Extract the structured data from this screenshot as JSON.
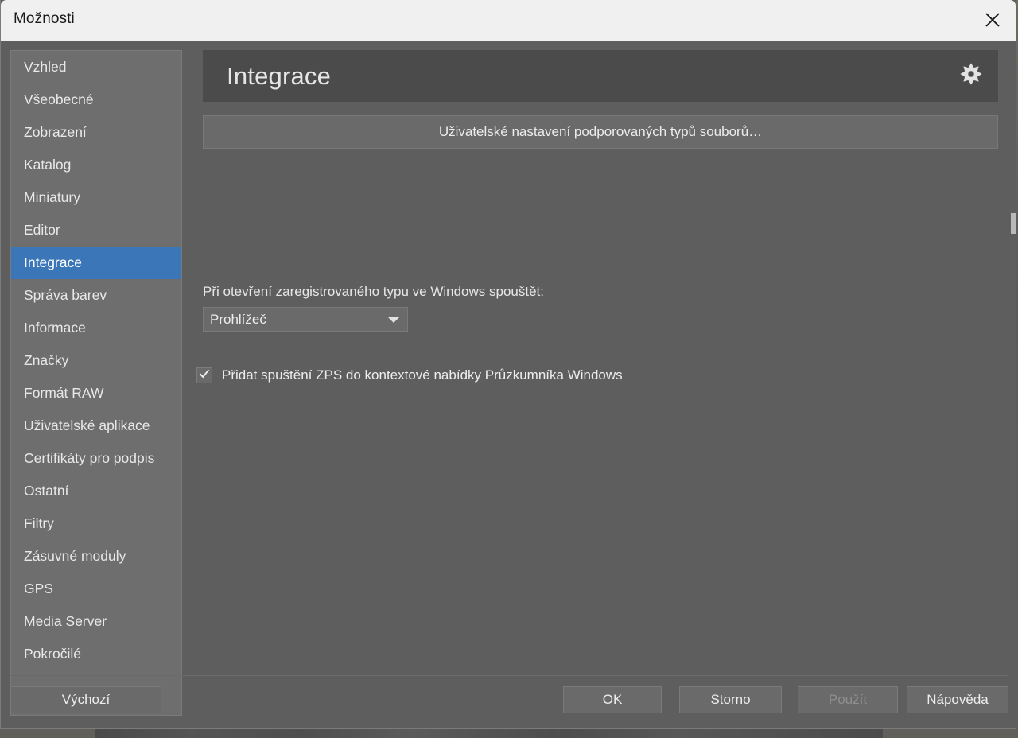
{
  "window": {
    "title": "Možnosti",
    "close_icon": "close-icon"
  },
  "sidebar": {
    "items": [
      {
        "label": "Vzhled",
        "selected": false
      },
      {
        "label": "Všeobecné",
        "selected": false
      },
      {
        "label": "Zobrazení",
        "selected": false
      },
      {
        "label": "Katalog",
        "selected": false
      },
      {
        "label": "Miniatury",
        "selected": false
      },
      {
        "label": "Editor",
        "selected": false
      },
      {
        "label": "Integrace",
        "selected": true
      },
      {
        "label": "Správa barev",
        "selected": false
      },
      {
        "label": "Informace",
        "selected": false
      },
      {
        "label": "Značky",
        "selected": false
      },
      {
        "label": "Formát RAW",
        "selected": false
      },
      {
        "label": "Uživatelské aplikace",
        "selected": false
      },
      {
        "label": "Certifikáty pro podpis",
        "selected": false
      },
      {
        "label": "Ostatní",
        "selected": false
      },
      {
        "label": "Filtry",
        "selected": false
      },
      {
        "label": "Zásuvné moduly",
        "selected": false
      },
      {
        "label": "GPS",
        "selected": false
      },
      {
        "label": "Media Server",
        "selected": false
      },
      {
        "label": "Pokročilé",
        "selected": false
      }
    ],
    "selected_label": "Integrace",
    "highlight_color": "#3b76b8"
  },
  "main": {
    "header": {
      "title": "Integrace",
      "settings_icon": "gear-icon"
    },
    "filetypes_button": {
      "label": "Uživatelské nastavení podporovaných typů souborů…"
    },
    "open_with": {
      "label": "Při otevření zaregistrovaného typu ve Windows spouštět:",
      "selected_value": "Prohlížeč",
      "arrow_icon": "chevron-down-icon"
    },
    "context_menu_option": {
      "label": "Přidat spuštění ZPS do kontextové nabídky Průzkumníka Windows",
      "checked": true,
      "check_icon": "check-icon"
    }
  },
  "footer": {
    "default_label": "Výchozí",
    "ok_label": "OK",
    "cancel_label": "Storno",
    "apply_label": "Použít",
    "apply_disabled": true,
    "help_label": "Nápověda"
  }
}
